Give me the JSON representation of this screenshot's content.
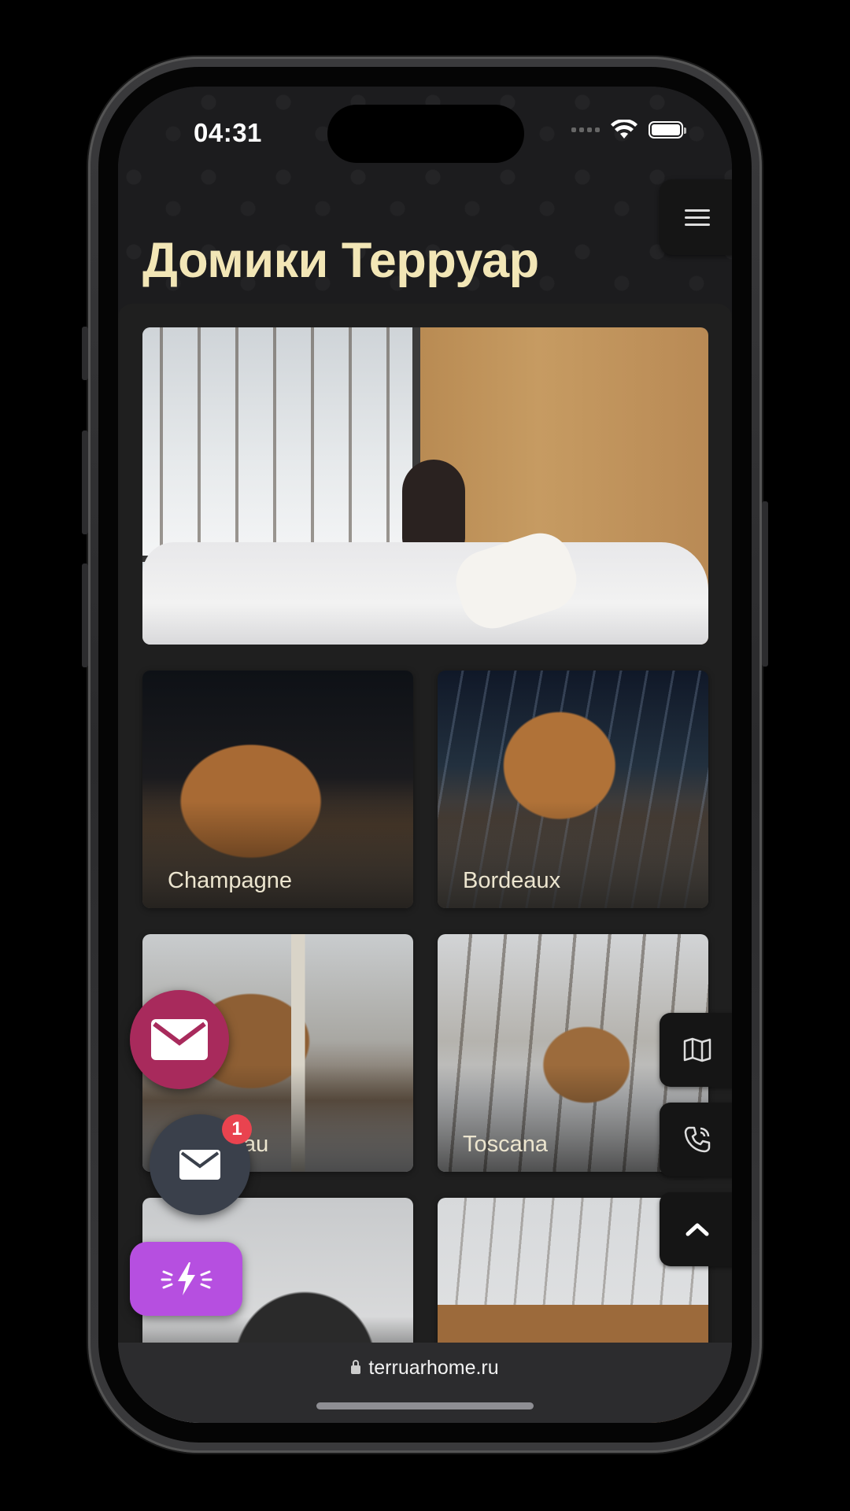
{
  "status_bar": {
    "time": "04:31"
  },
  "page": {
    "title": "Домики Терруар"
  },
  "menu": {
    "icon": "hamburger-icon"
  },
  "hero": {
    "image": "woman-in-cabin-bed-winter-window"
  },
  "houses": [
    {
      "name": "Champagne"
    },
    {
      "name": "Bordeaux"
    },
    {
      "name": "au"
    },
    {
      "name": "Toscana"
    },
    {
      "name": ""
    },
    {
      "name": ""
    }
  ],
  "floating": {
    "mail_big_icon": "envelope-icon",
    "mail_small_icon": "envelope-icon",
    "badge_count": "1",
    "flash_icon": "lightning-icon"
  },
  "side_tools": {
    "map_icon": "map-icon",
    "phone_icon": "phone-icon",
    "up_icon": "chevron-up-icon"
  },
  "browser": {
    "url": "terruarhome.ru"
  },
  "colors": {
    "title": "#f2e6b6",
    "mail_big": "#a82a5c",
    "mail_small": "#3a404b",
    "flash": "#b64fe0",
    "badge": "#e9434f"
  }
}
